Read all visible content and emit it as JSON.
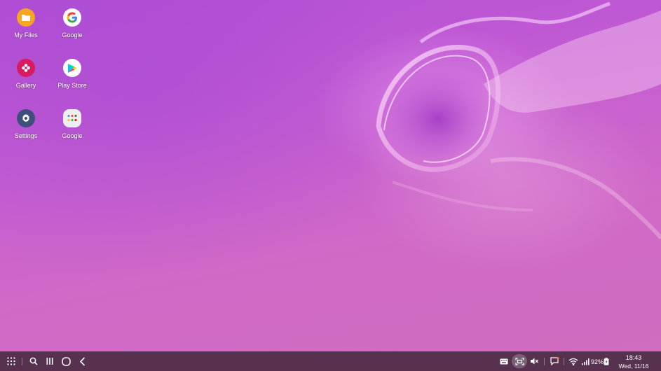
{
  "desktop": {
    "icons": [
      {
        "label": "My Files",
        "icon": "folder-icon",
        "color": "#f6a623"
      },
      {
        "label": "Google",
        "icon": "google-g-icon",
        "color": "#ffffff"
      },
      {
        "label": "Gallery",
        "icon": "flower-icon",
        "color": "#d81b60"
      },
      {
        "label": "Play Store",
        "icon": "play-store-icon",
        "color": "#ffffff"
      },
      {
        "label": "Settings",
        "icon": "gear-icon",
        "color": "#3d4f7a"
      },
      {
        "label": "Google",
        "icon": "folder-group-icon",
        "color": "#eeeeee"
      }
    ]
  },
  "taskbar": {
    "apps_button": "apps-grid-icon",
    "search_button": "search-icon",
    "recents_button": "recents-icon",
    "home_button": "home-icon",
    "back_button": "back-icon",
    "tray": {
      "keyboard": "keyboard-icon",
      "screenshot": "screen-capture-icon",
      "sound": "mute-icon",
      "notifications": "notification-icon",
      "wifi": "wifi-icon",
      "signal": "signal-icon",
      "battery_percent": "92%",
      "battery": "battery-icon"
    },
    "clock": {
      "time": "18:43",
      "date": "Wed, 11/16"
    }
  },
  "colors": {
    "taskbar_bg": "#56324e",
    "wallpaper_accent": "#c45bd3"
  }
}
